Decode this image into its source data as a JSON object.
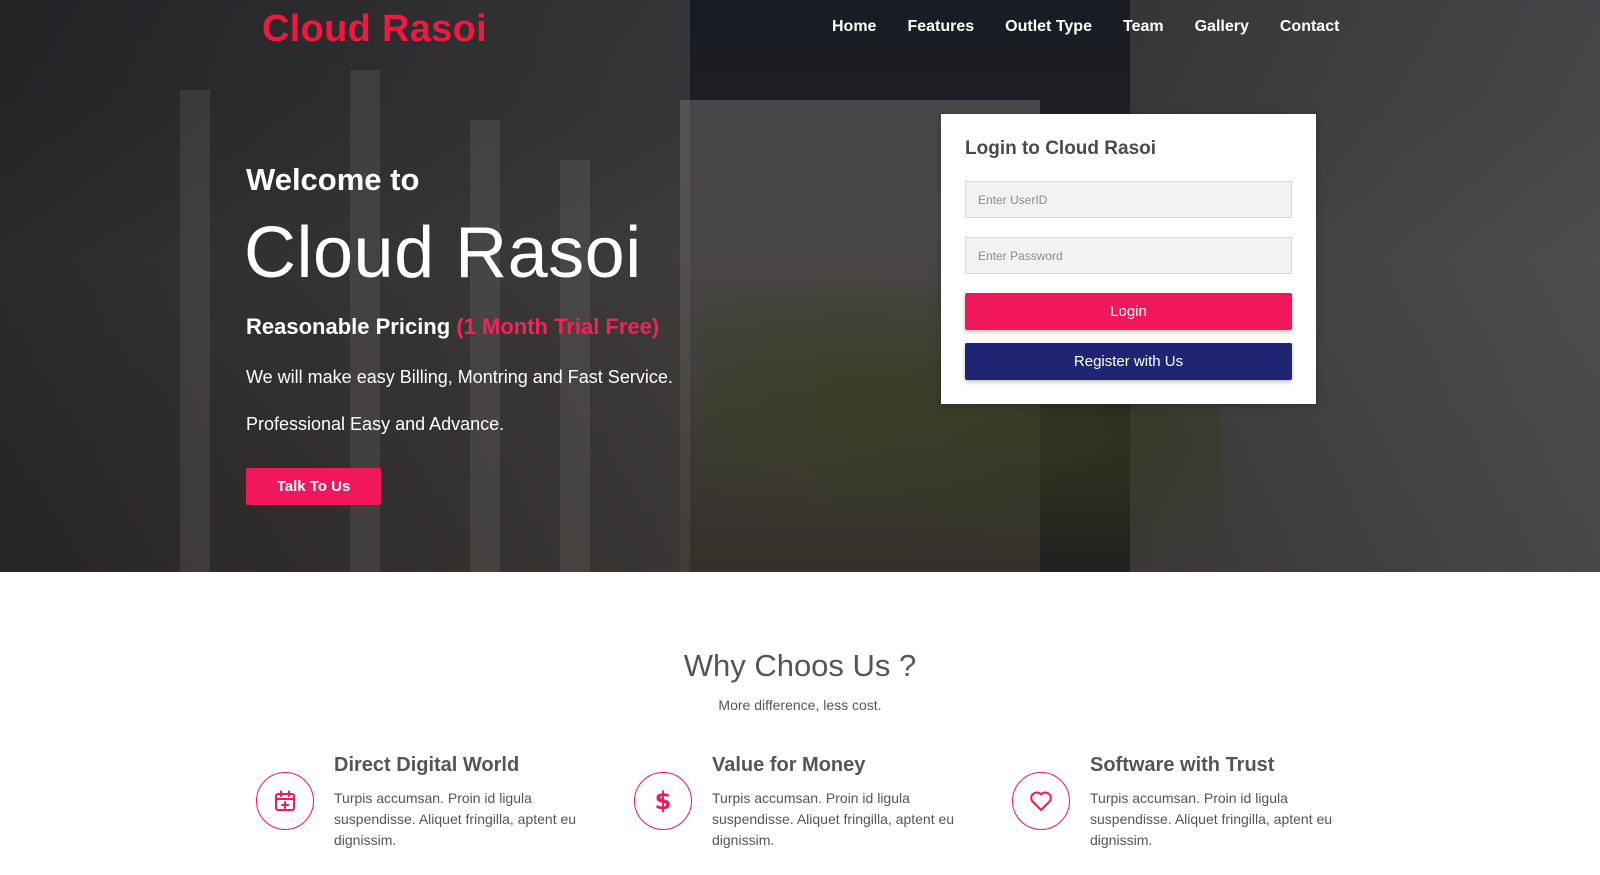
{
  "brand": {
    "name": "Cloud Rasoi"
  },
  "nav": {
    "items": [
      {
        "label": "Home"
      },
      {
        "label": "Features"
      },
      {
        "label": "Outlet Type"
      },
      {
        "label": "Team"
      },
      {
        "label": "Gallery"
      },
      {
        "label": "Contact"
      }
    ]
  },
  "hero": {
    "welcome": "Welcome to",
    "title": "Cloud Rasoi",
    "pricing_label": "Reasonable Pricing",
    "pricing_offer": "(1 Month Trial Free)",
    "line1": "We will make easy Billing, Montring and Fast Service.",
    "line2": "Professional Easy and Advance.",
    "cta_label": "Talk To Us"
  },
  "login": {
    "heading": "Login to Cloud Rasoi",
    "userid_placeholder": "Enter UserID",
    "password_placeholder": "Enter Password",
    "login_label": "Login",
    "register_label": "Register with Us"
  },
  "why": {
    "title": "Why Choos Us ?",
    "subtitle": "More difference, less cost.",
    "features": [
      {
        "icon": "calendar-plus-icon",
        "title": "Direct Digital World",
        "text": "Turpis accumsan. Proin id ligula suspendisse. Aliquet fringilla, aptent eu dignissim."
      },
      {
        "icon": "dollar-icon",
        "title": "Value for Money",
        "text": "Turpis accumsan. Proin id ligula suspendisse. Aliquet fringilla, aptent eu dignissim."
      },
      {
        "icon": "heart-icon",
        "title": "Software with Trust",
        "text": "Turpis accumsan. Proin id ligula suspendisse. Aliquet fringilla, aptent eu dignissim."
      }
    ]
  },
  "colors": {
    "accent": "#f0185a",
    "brand": "#f0183f",
    "register": "#1f2473"
  }
}
